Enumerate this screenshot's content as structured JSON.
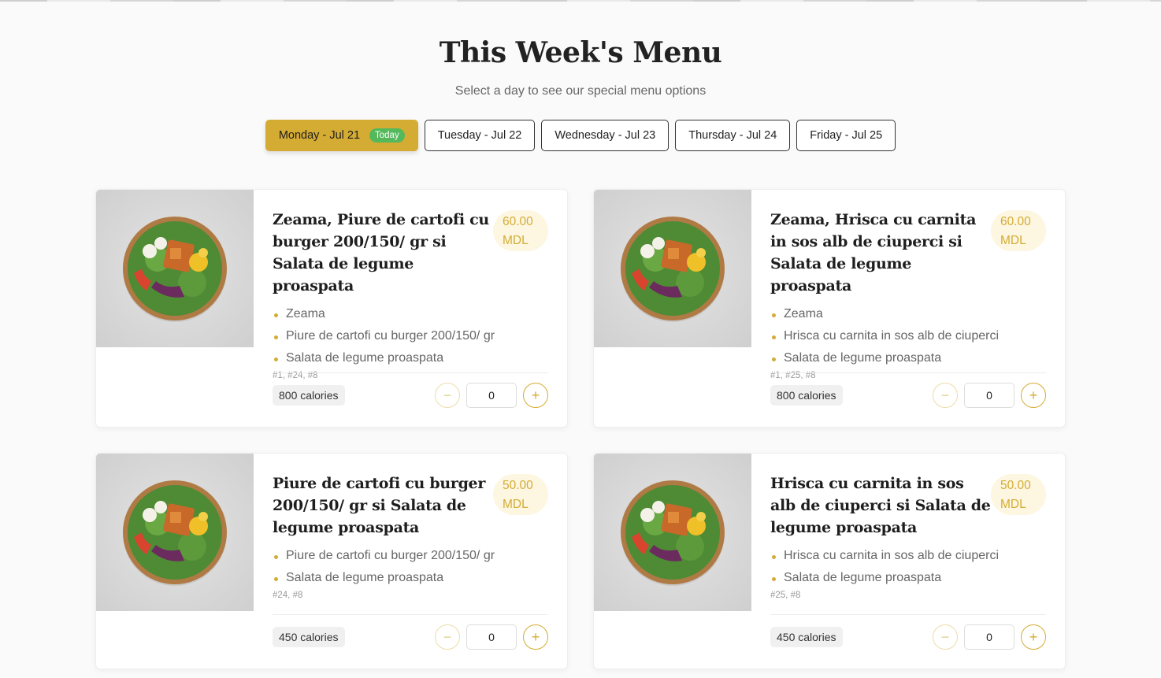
{
  "header": {
    "title": "This Week's Menu",
    "subtitle": "Select a day to see our special menu options"
  },
  "days": [
    {
      "label": "Monday - Jul 21",
      "badge": "Today",
      "active": true
    },
    {
      "label": "Tuesday - Jul 22"
    },
    {
      "label": "Wednesday - Jul 23"
    },
    {
      "label": "Thursday - Jul 24"
    },
    {
      "label": "Friday - Jul 25"
    }
  ],
  "menu": [
    {
      "name": "Zeama, Piure de cartofi cu burger 200/150/ gr si Salata de legume proaspata",
      "price": "60.00",
      "currency": "MDL",
      "items": [
        "Zeama",
        "Piure de cartofi cu burger 200/150/ gr",
        "Salata de legume proaspata"
      ],
      "codes": "#1, #24, #8",
      "calories": "800 calories",
      "quantity": "0"
    },
    {
      "name": "Zeama, Hrisca cu carnita in sos alb de ciuperci si Salata de legume proaspata",
      "price": "60.00",
      "currency": "MDL",
      "items": [
        "Zeama",
        "Hrisca cu carnita in sos alb de ciuperci",
        "Salata de legume proaspata"
      ],
      "codes": "#1, #25, #8",
      "calories": "800 calories",
      "quantity": "0"
    },
    {
      "name": "Piure de cartofi cu burger 200/150/ gr si Salata de legume proaspata",
      "price": "50.00",
      "currency": "MDL",
      "items": [
        "Piure de cartofi cu burger 200/150/ gr",
        "Salata de legume proaspata"
      ],
      "codes": "#24, #8",
      "calories": "450 calories",
      "quantity": "0"
    },
    {
      "name": "Hrisca cu carnita in sos alb de ciuperci si Salata de legume proaspata",
      "price": "50.00",
      "currency": "MDL",
      "items": [
        "Hrisca cu carnita in sos alb de ciuperci",
        "Salata de legume proaspata"
      ],
      "codes": "#25, #8",
      "calories": "450 calories",
      "quantity": "0"
    }
  ],
  "icons": {
    "decrement": "minus-icon",
    "increment": "plus-icon"
  },
  "colors": {
    "accent": "#d4ac34",
    "today_badge": "#54b95a"
  }
}
